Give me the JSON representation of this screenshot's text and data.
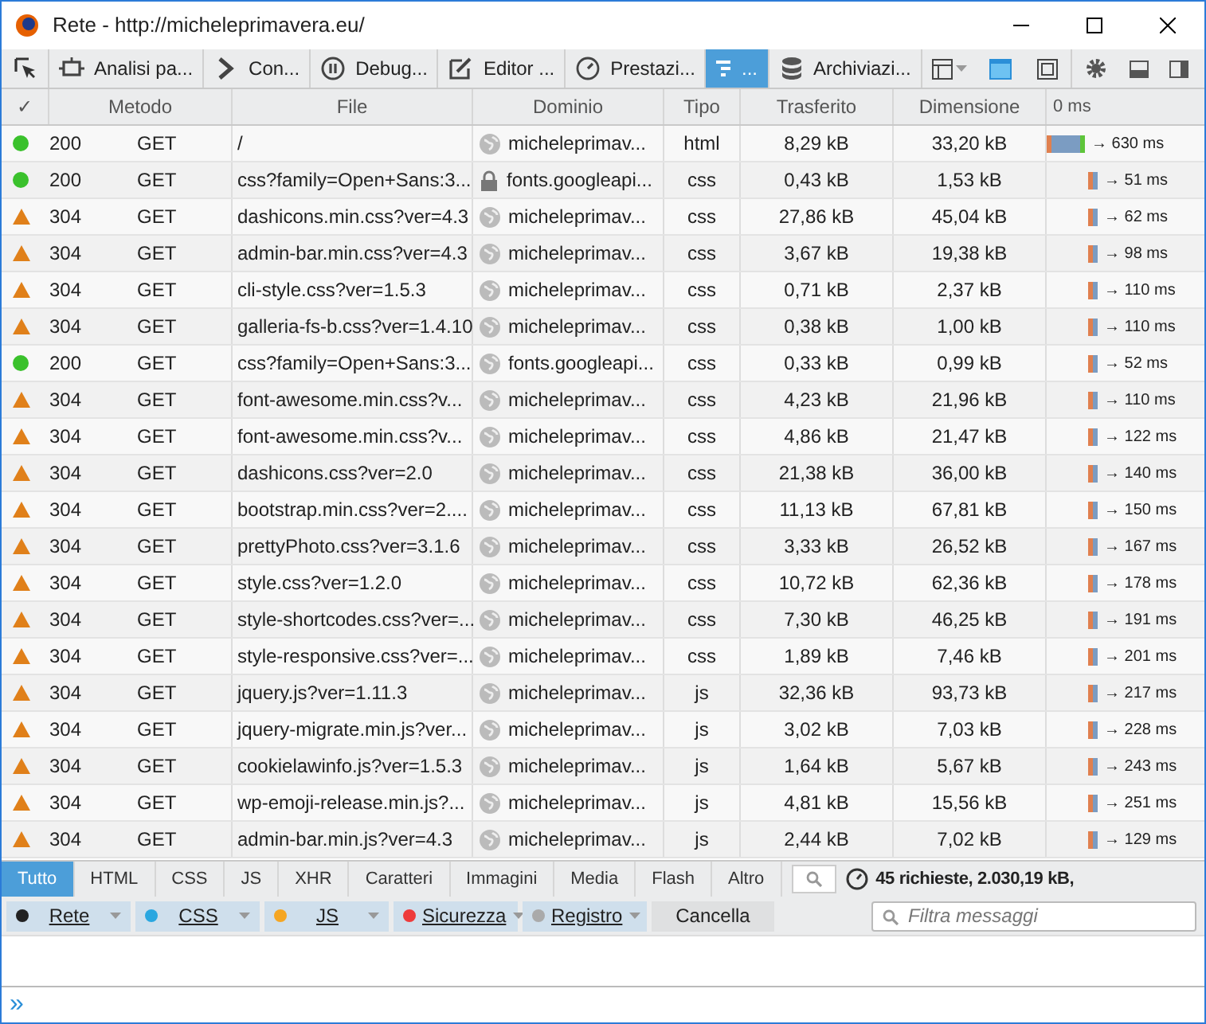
{
  "window": {
    "title": "Rete - http://micheleprimavera.eu/"
  },
  "tools": [
    {
      "label": "Analisi pa...",
      "selected": false
    },
    {
      "label": "Con...",
      "selected": false
    },
    {
      "label": "Debug...",
      "selected": false
    },
    {
      "label": "Editor ...",
      "selected": false
    },
    {
      "label": "Prestazi...",
      "selected": false
    },
    {
      "label": "...",
      "selected": true
    },
    {
      "label": "Archiviazi...",
      "selected": false
    }
  ],
  "table": {
    "columns": [
      "✓",
      "Metodo",
      "File",
      "Dominio",
      "Tipo",
      "Trasferito",
      "Dimensione",
      "0 ms"
    ],
    "rows": [
      {
        "kind": "ok",
        "status": "200",
        "method": "GET",
        "file": "/",
        "secure": false,
        "domain": "micheleprimav...",
        "type": "html",
        "transferred": "8,29 kB",
        "size": "33,20 kB",
        "time": "→ 630 ms"
      },
      {
        "kind": "ok",
        "status": "200",
        "method": "GET",
        "file": "css?family=Open+Sans:3...",
        "secure": true,
        "domain": "fonts.googleapi...",
        "type": "css",
        "transferred": "0,43 kB",
        "size": "1,53 kB",
        "time": "→ 51 ms"
      },
      {
        "kind": "cached",
        "status": "304",
        "method": "GET",
        "file": "dashicons.min.css?ver=4.3",
        "secure": false,
        "domain": "micheleprimav...",
        "type": "css",
        "transferred": "27,86 kB",
        "size": "45,04 kB",
        "time": "→ 62 ms"
      },
      {
        "kind": "cached",
        "status": "304",
        "method": "GET",
        "file": "admin-bar.min.css?ver=4.3",
        "secure": false,
        "domain": "micheleprimav...",
        "type": "css",
        "transferred": "3,67 kB",
        "size": "19,38 kB",
        "time": "→ 98 ms"
      },
      {
        "kind": "cached",
        "status": "304",
        "method": "GET",
        "file": "cli-style.css?ver=1.5.3",
        "secure": false,
        "domain": "micheleprimav...",
        "type": "css",
        "transferred": "0,71 kB",
        "size": "2,37 kB",
        "time": "→ 110 ms"
      },
      {
        "kind": "cached",
        "status": "304",
        "method": "GET",
        "file": "galleria-fs-b.css?ver=1.4.10",
        "secure": false,
        "domain": "micheleprimav...",
        "type": "css",
        "transferred": "0,38 kB",
        "size": "1,00 kB",
        "time": "→ 110 ms"
      },
      {
        "kind": "ok",
        "status": "200",
        "method": "GET",
        "file": "css?family=Open+Sans:3...",
        "secure": false,
        "domain": "fonts.googleapi...",
        "type": "css",
        "transferred": "0,33 kB",
        "size": "0,99 kB",
        "time": "→ 52 ms"
      },
      {
        "kind": "cached",
        "status": "304",
        "method": "GET",
        "file": "font-awesome.min.css?v...",
        "secure": false,
        "domain": "micheleprimav...",
        "type": "css",
        "transferred": "4,23 kB",
        "size": "21,96 kB",
        "time": "→ 110 ms"
      },
      {
        "kind": "cached",
        "status": "304",
        "method": "GET",
        "file": "font-awesome.min.css?v...",
        "secure": false,
        "domain": "micheleprimav...",
        "type": "css",
        "transferred": "4,86 kB",
        "size": "21,47 kB",
        "time": "→ 122 ms"
      },
      {
        "kind": "cached",
        "status": "304",
        "method": "GET",
        "file": "dashicons.css?ver=2.0",
        "secure": false,
        "domain": "micheleprimav...",
        "type": "css",
        "transferred": "21,38 kB",
        "size": "36,00 kB",
        "time": "→ 140 ms"
      },
      {
        "kind": "cached",
        "status": "304",
        "method": "GET",
        "file": "bootstrap.min.css?ver=2....",
        "secure": false,
        "domain": "micheleprimav...",
        "type": "css",
        "transferred": "11,13 kB",
        "size": "67,81 kB",
        "time": "→ 150 ms"
      },
      {
        "kind": "cached",
        "status": "304",
        "method": "GET",
        "file": "prettyPhoto.css?ver=3.1.6",
        "secure": false,
        "domain": "micheleprimav...",
        "type": "css",
        "transferred": "3,33 kB",
        "size": "26,52 kB",
        "time": "→ 167 ms"
      },
      {
        "kind": "cached",
        "status": "304",
        "method": "GET",
        "file": "style.css?ver=1.2.0",
        "secure": false,
        "domain": "micheleprimav...",
        "type": "css",
        "transferred": "10,72 kB",
        "size": "62,36 kB",
        "time": "→ 178 ms"
      },
      {
        "kind": "cached",
        "status": "304",
        "method": "GET",
        "file": "style-shortcodes.css?ver=...",
        "secure": false,
        "domain": "micheleprimav...",
        "type": "css",
        "transferred": "7,30 kB",
        "size": "46,25 kB",
        "time": "→ 191 ms"
      },
      {
        "kind": "cached",
        "status": "304",
        "method": "GET",
        "file": "style-responsive.css?ver=...",
        "secure": false,
        "domain": "micheleprimav...",
        "type": "css",
        "transferred": "1,89 kB",
        "size": "7,46 kB",
        "time": "→ 201 ms"
      },
      {
        "kind": "cached",
        "status": "304",
        "method": "GET",
        "file": "jquery.js?ver=1.11.3",
        "secure": false,
        "domain": "micheleprimav...",
        "type": "js",
        "transferred": "32,36 kB",
        "size": "93,73 kB",
        "time": "→ 217 ms"
      },
      {
        "kind": "cached",
        "status": "304",
        "method": "GET",
        "file": "jquery-migrate.min.js?ver...",
        "secure": false,
        "domain": "micheleprimav...",
        "type": "js",
        "transferred": "3,02 kB",
        "size": "7,03 kB",
        "time": "→ 228 ms"
      },
      {
        "kind": "cached",
        "status": "304",
        "method": "GET",
        "file": "cookielawinfo.js?ver=1.5.3",
        "secure": false,
        "domain": "micheleprimav...",
        "type": "js",
        "transferred": "1,64 kB",
        "size": "5,67 kB",
        "time": "→ 243 ms"
      },
      {
        "kind": "cached",
        "status": "304",
        "method": "GET",
        "file": "wp-emoji-release.min.js?...",
        "secure": false,
        "domain": "micheleprimav...",
        "type": "js",
        "transferred": "4,81 kB",
        "size": "15,56 kB",
        "time": "→ 251 ms"
      },
      {
        "kind": "cached",
        "status": "304",
        "method": "GET",
        "file": "admin-bar.min.js?ver=4.3",
        "secure": false,
        "domain": "micheleprimav...",
        "type": "js",
        "transferred": "2,44 kB",
        "size": "7,02 kB",
        "time": "→ 129 ms"
      }
    ]
  },
  "filters": [
    {
      "label": "Tutto",
      "selected": true
    },
    {
      "label": "HTML",
      "selected": false
    },
    {
      "label": "CSS",
      "selected": false
    },
    {
      "label": "JS",
      "selected": false
    },
    {
      "label": "XHR",
      "selected": false
    },
    {
      "label": "Caratteri",
      "selected": false
    },
    {
      "label": "Immagini",
      "selected": false
    },
    {
      "label": "Media",
      "selected": false
    },
    {
      "label": "Flash",
      "selected": false
    },
    {
      "label": "Altro",
      "selected": false
    }
  ],
  "summary": "45 richieste, 2.030,19 kB,",
  "console_filters": [
    {
      "label": "Rete",
      "color": "#222222"
    },
    {
      "label": "CSS",
      "color": "#2aa7e0"
    },
    {
      "label": "JS",
      "color": "#f5a623"
    },
    {
      "label": "Sicurezza",
      "color": "#ee3b3b"
    },
    {
      "label": "Registro",
      "color": "#aaaaaa"
    }
  ],
  "clear_button": "Cancella",
  "message_filter": {
    "placeholder": "Filtra messaggi"
  },
  "prompt": "»"
}
